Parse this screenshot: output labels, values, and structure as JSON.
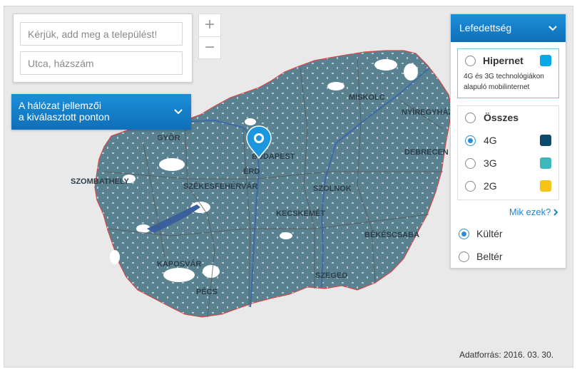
{
  "search": {
    "settlement_placeholder": "Kérjük, add meg a települést!",
    "street_placeholder": "Utca, házszám"
  },
  "zoom": {
    "in_label": "+",
    "out_label": "−"
  },
  "network_bar": {
    "line1": "A hálózat jellemzői",
    "line2": "a kiválasztott ponton"
  },
  "coverage_panel": {
    "title": "Lefedettség",
    "hipernet": {
      "label": "Hipernet",
      "description": "4G és 3G technológiákon alapuló mobilinternet",
      "color": "#0aa8e8",
      "selected": false
    },
    "technologies": [
      {
        "label": "Összes",
        "selected": false
      },
      {
        "label": "4G",
        "color": "#0c4a6b",
        "selected": true
      },
      {
        "label": "3G",
        "color": "#3db7b8",
        "selected": false
      },
      {
        "label": "2G",
        "color": "#f6c318",
        "selected": false
      }
    ],
    "mik_ezek": "Mik ezek?",
    "environments": [
      {
        "label": "Kültér",
        "selected": true
      },
      {
        "label": "Beltér",
        "selected": false
      }
    ]
  },
  "map": {
    "coverage_color": "#5a8190",
    "cities": [
      "GYŐR",
      "BUDAPEST",
      "ÉRD",
      "MISKOLC",
      "NYÍREGYHÁZA",
      "DEBRECEN",
      "SZOMBATHELY",
      "SZÉKESFEHÉRVÁR",
      "SZOLNOK",
      "KECSKEMÉT",
      "BÉKÉSCSABA",
      "KAPOSVÁR",
      "PÉCS",
      "SZEGED"
    ]
  },
  "source_text": "Adatforrás: 2016. 03. 30."
}
